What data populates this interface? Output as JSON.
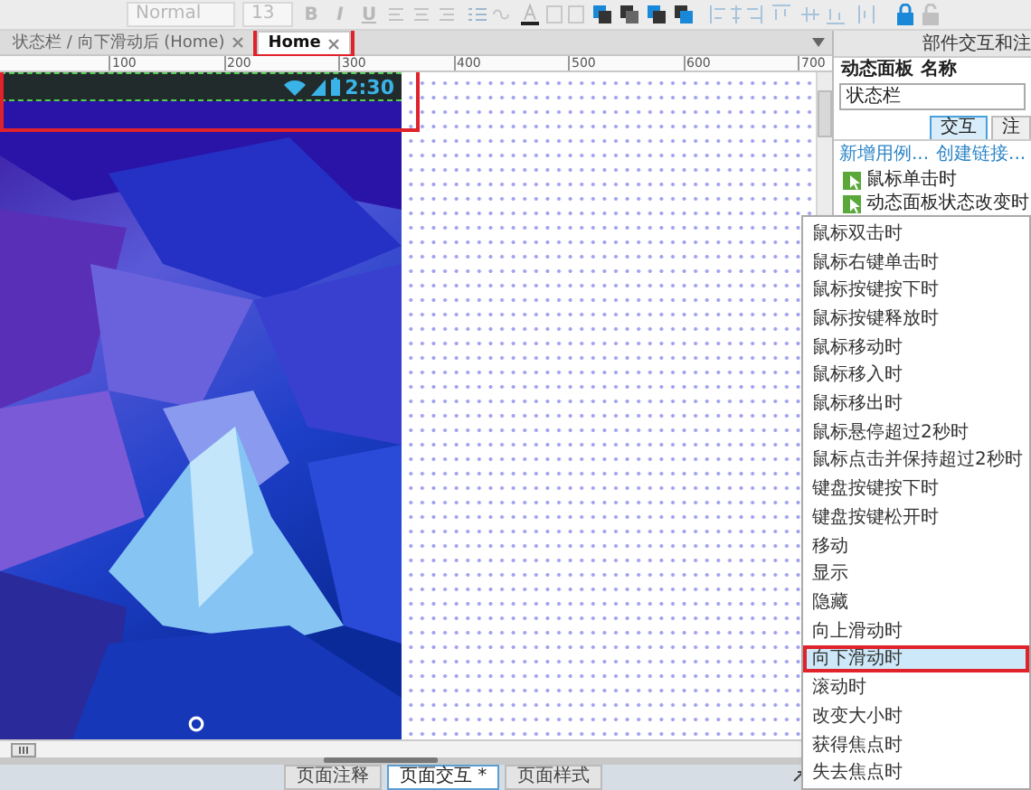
{
  "toolbar": {
    "font_style": "Normal",
    "font_size": "13",
    "format_buttons": [
      "B",
      "I",
      "U"
    ]
  },
  "document_tabs": [
    {
      "label": "状态栏 / 向下滑动后 (Home)",
      "selected": false,
      "highlighted": false
    },
    {
      "label": "Home",
      "selected": true,
      "highlighted": true
    }
  ],
  "ruler": {
    "ticks": [
      "100",
      "200",
      "300",
      "400",
      "500",
      "600",
      "700"
    ]
  },
  "status_bar": {
    "time": "2:30",
    "highlighted": true
  },
  "panel": {
    "title": "部件交互和注",
    "widget_type_label": "动态面板",
    "name_label": "名称",
    "name_value": "状态栏",
    "tabs": [
      {
        "label": "交互",
        "selected": true
      },
      {
        "label": "注",
        "selected": false
      }
    ],
    "links": [
      "新增用例...",
      "创建链接..."
    ],
    "events": [
      "鼠标单击时",
      "动态面板状态改变时"
    ]
  },
  "context_menu": {
    "items": [
      {
        "label": "鼠标双击时",
        "selected": false,
        "highlighted": false
      },
      {
        "label": "鼠标右键单击时",
        "selected": false,
        "highlighted": false
      },
      {
        "label": "鼠标按键按下时",
        "selected": false,
        "highlighted": false
      },
      {
        "label": "鼠标按键释放时",
        "selected": false,
        "highlighted": false
      },
      {
        "label": "鼠标移动时",
        "selected": false,
        "highlighted": false
      },
      {
        "label": "鼠标移入时",
        "selected": false,
        "highlighted": false
      },
      {
        "label": "鼠标移出时",
        "selected": false,
        "highlighted": false
      },
      {
        "label": "鼠标悬停超过2秒时",
        "selected": false,
        "highlighted": false
      },
      {
        "label": "鼠标点击并保持超过2秒时",
        "selected": false,
        "highlighted": false
      },
      {
        "label": "键盘按键按下时",
        "selected": false,
        "highlighted": false
      },
      {
        "label": "键盘按键松开时",
        "selected": false,
        "highlighted": false
      },
      {
        "label": "移动",
        "selected": false,
        "highlighted": false
      },
      {
        "label": "显示",
        "selected": false,
        "highlighted": false
      },
      {
        "label": "隐藏",
        "selected": false,
        "highlighted": false
      },
      {
        "label": "向上滑动时",
        "selected": false,
        "highlighted": false
      },
      {
        "label": "向下滑动时",
        "selected": true,
        "highlighted": true
      },
      {
        "label": "滚动时",
        "selected": false,
        "highlighted": false
      },
      {
        "label": "改变大小时",
        "selected": false,
        "highlighted": false
      },
      {
        "label": "获得焦点时",
        "selected": false,
        "highlighted": false
      },
      {
        "label": "失去焦点时",
        "selected": false,
        "highlighted": false
      }
    ]
  },
  "bottom_tabs": [
    {
      "label": "页面注释",
      "selected": false
    },
    {
      "label": "页面交互 *",
      "selected": true
    },
    {
      "label": "页面样式",
      "selected": false
    }
  ]
}
